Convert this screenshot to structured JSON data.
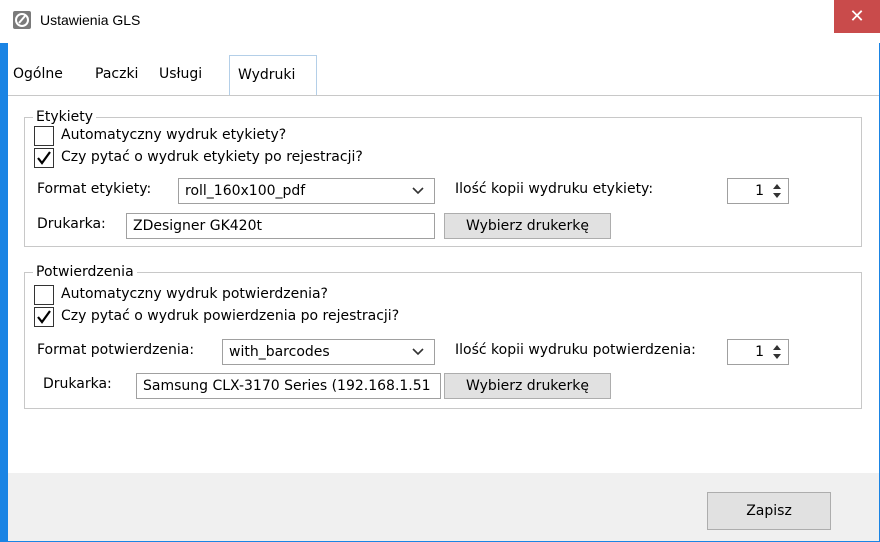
{
  "window": {
    "title": "Ustawienia GLS",
    "close_glyph": "✕",
    "icon": "app-logo-icon",
    "accent": "#1a84e4",
    "close_color": "#c94b4b"
  },
  "tabs": [
    {
      "label": "Ogólne",
      "active": false
    },
    {
      "label": "Paczki",
      "active": false
    },
    {
      "label": "Usługi",
      "active": false
    },
    {
      "label": "Wydruki",
      "active": true
    }
  ],
  "labels_group": {
    "title": "Etykiety",
    "auto_print_label": "Automatyczny wydruk etykiety?",
    "auto_print_checked": false,
    "ask_print_label": "Czy pytać o wydruk etykiety po rejestracji?",
    "ask_print_checked": true,
    "format_label": "Format etykiety:",
    "format_value": "roll_160x100_pdf",
    "copies_label": "Ilość kopii wydruku etykiety:",
    "copies_value": "1",
    "printer_label": "Drukarka:",
    "printer_value": "ZDesigner GK420t",
    "choose_printer_button": "Wybierz drukerkę"
  },
  "confirmations_group": {
    "title": "Potwierdzenia",
    "auto_print_label": "Automatyczny wydruk potwierdzenia?",
    "auto_print_checked": false,
    "ask_print_label": "Czy pytać o wydruk powierdzenia po rejestracji?",
    "ask_print_checked": true,
    "format_label": "Format potwierdzenia:",
    "format_value": "with_barcodes",
    "copies_label": "Ilość kopii wydruku potwierdzenia:",
    "copies_value": "1",
    "printer_label": "Drukarka:",
    "printer_value": "Samsung CLX-3170 Series (192.168.1.51",
    "choose_printer_button": "Wybierz drukerkę"
  },
  "footer": {
    "save_button": "Zapisz"
  }
}
